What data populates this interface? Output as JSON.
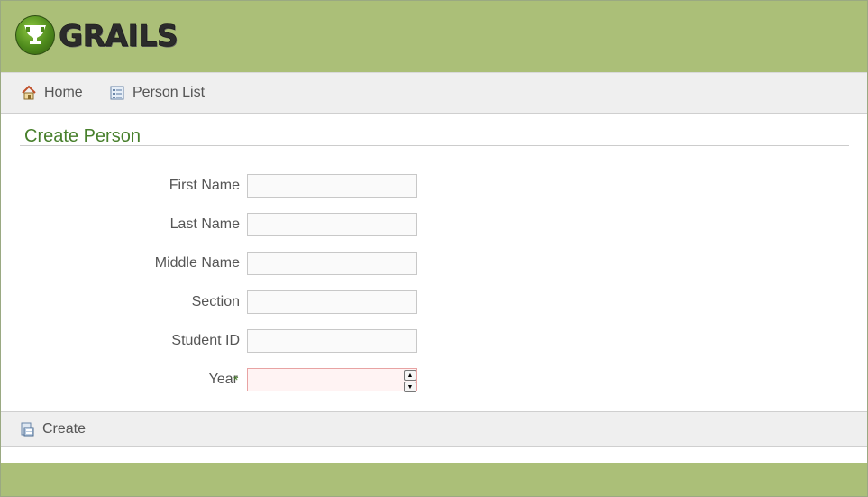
{
  "header": {
    "logo_text": "GRAILS"
  },
  "nav": {
    "home_label": "Home",
    "list_label": "Person List"
  },
  "form": {
    "title": "Create Person",
    "fields": [
      {
        "label": "First Name",
        "value": "",
        "required": false
      },
      {
        "label": "Last Name",
        "value": "",
        "required": false
      },
      {
        "label": "Middle Name",
        "value": "",
        "required": false
      },
      {
        "label": "Section",
        "value": "",
        "required": false
      },
      {
        "label": "Student ID",
        "value": "",
        "required": false
      },
      {
        "label": "Year",
        "value": "",
        "required": true,
        "required_mark": "*"
      }
    ]
  },
  "buttons": {
    "create_label": "Create"
  },
  "colors": {
    "header_bg": "#abbf78",
    "title_color": "#48802c",
    "nav_bg": "#efefef",
    "error_field_bg": "#fff3f3"
  }
}
